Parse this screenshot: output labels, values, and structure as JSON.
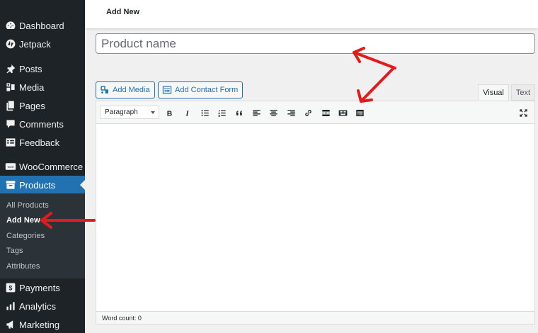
{
  "sidebar": {
    "items": [
      {
        "label": "Dashboard",
        "icon": "dashboard-icon"
      },
      {
        "label": "Jetpack",
        "icon": "jetpack-icon"
      },
      {
        "label": "Posts",
        "icon": "pin-icon"
      },
      {
        "label": "Media",
        "icon": "media-icon"
      },
      {
        "label": "Pages",
        "icon": "pages-icon"
      },
      {
        "label": "Comments",
        "icon": "comment-icon"
      },
      {
        "label": "Feedback",
        "icon": "feedback-icon"
      },
      {
        "label": "WooCommerce",
        "icon": "woo-icon"
      },
      {
        "label": "Products",
        "icon": "archive-icon"
      },
      {
        "label": "Payments",
        "icon": "dollar-icon"
      },
      {
        "label": "Analytics",
        "icon": "bar-chart-icon"
      },
      {
        "label": "Marketing",
        "icon": "megaphone-icon"
      }
    ],
    "woo_badge": "woo",
    "payments_badge": "$",
    "submenu": [
      "All Products",
      "Add New",
      "Categories",
      "Tags",
      "Attributes"
    ]
  },
  "header": {
    "title": "Add New"
  },
  "title_field": {
    "placeholder": "Product name"
  },
  "media_buttons": {
    "add_media": "Add Media",
    "add_contact_form": "Add Contact Form"
  },
  "editor": {
    "tabs": {
      "visual": "Visual",
      "text": "Text"
    },
    "format_select": "Paragraph",
    "toolbar_icons": [
      "bold-icon",
      "italic-icon",
      "bulleted-list-icon",
      "numbered-list-icon",
      "blockquote-icon",
      "align-left-icon",
      "align-center-icon",
      "align-right-icon",
      "link-icon",
      "read-more-icon",
      "toolbar-toggle-icon",
      "form-icon",
      "fullscreen-icon"
    ],
    "word_count": "Word count: 0"
  },
  "colors": {
    "sidebar_bg": "#1d2327",
    "accent": "#2271b1",
    "annotation": "#e31b1b"
  }
}
